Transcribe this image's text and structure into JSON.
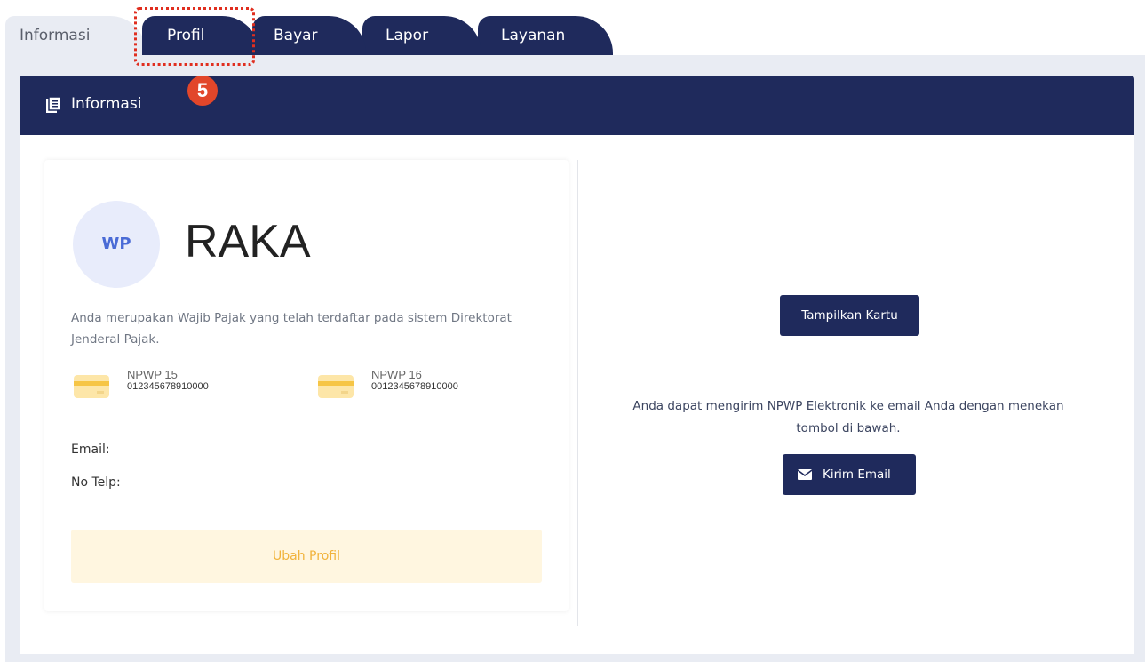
{
  "tabs": [
    {
      "label": "Informasi"
    },
    {
      "label": "Profil"
    },
    {
      "label": "Bayar"
    },
    {
      "label": "Lapor"
    },
    {
      "label": "Layanan"
    }
  ],
  "step_badge": "5",
  "header": {
    "title": "Informasi",
    "icon": "document-icon"
  },
  "profile": {
    "avatar": "WP",
    "name": "RAKA",
    "description": "Anda merupakan Wajib Pajak yang telah terdaftar pada sistem Direktorat Jenderal Pajak.",
    "npwp15": {
      "label": "NPWP 15",
      "value": "012345678910000",
      "icon": "card-icon"
    },
    "npwp16": {
      "label": "NPWP 16",
      "value": "0012345678910000",
      "icon": "card-icon"
    },
    "email_label": "Email:",
    "telp_label": "No Telp:",
    "edit_button": "Ubah Profil"
  },
  "actions": {
    "show_card_button": "Tampilkan Kartu",
    "send_text": "Anda dapat mengirim NPWP Elektronik ke email Anda dengan menekan tombol di bawah.",
    "send_email_button": "Kirim Email",
    "send_email_icon": "envelope-icon"
  },
  "colors": {
    "primary": "#1f2a5c",
    "highlight": "#e02e1f",
    "accent_yellow": "#f1b33b"
  }
}
